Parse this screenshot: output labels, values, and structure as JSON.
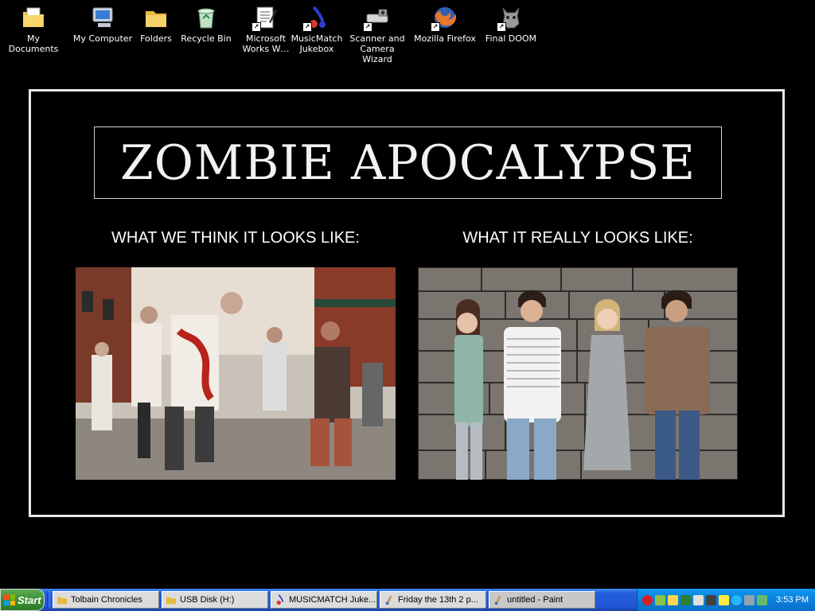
{
  "desktop": {
    "icons": [
      {
        "label": "My Documents",
        "icon": "my-documents-icon"
      },
      {
        "label": "My Computer",
        "icon": "my-computer-icon"
      },
      {
        "label": "Folders",
        "icon": "folder-icon"
      },
      {
        "label": "Recycle Bin",
        "icon": "recycle-bin-icon"
      },
      {
        "label": "Microsoft Works W…",
        "icon": "works-icon"
      },
      {
        "label": "MusicMatch Jukebox",
        "icon": "musicmatch-icon"
      },
      {
        "label": "Scanner and Camera Wizard",
        "icon": "scanner-icon"
      },
      {
        "label": "Mozilla Firefox",
        "icon": "firefox-icon"
      },
      {
        "label": "Final DOOM",
        "icon": "doom-icon"
      }
    ]
  },
  "poster": {
    "title": "ZOMBIE APOCALYPSE",
    "left_caption": "WHAT WE THINK IT LOOKS LIKE:",
    "right_caption": "WHAT IT REALLY LOOKS LIKE:"
  },
  "taskbar": {
    "start_label": "Start",
    "tasks": [
      {
        "label": "Tolbain Chronicles",
        "icon": "folder-icon"
      },
      {
        "label": "USB Disk (H:)",
        "icon": "folder-icon"
      },
      {
        "label": "MUSICMATCH Juke...",
        "icon": "musicmatch-icon"
      },
      {
        "label": "Friday the 13th 2 p...",
        "icon": "paint-icon"
      },
      {
        "label": "untitled - Paint",
        "icon": "paint-icon"
      }
    ],
    "clock": "3:53 PM"
  },
  "colors": {
    "taskbar_blue": "#245edb",
    "start_green": "#3c8f34",
    "tray_blue": "#0b80dd"
  }
}
